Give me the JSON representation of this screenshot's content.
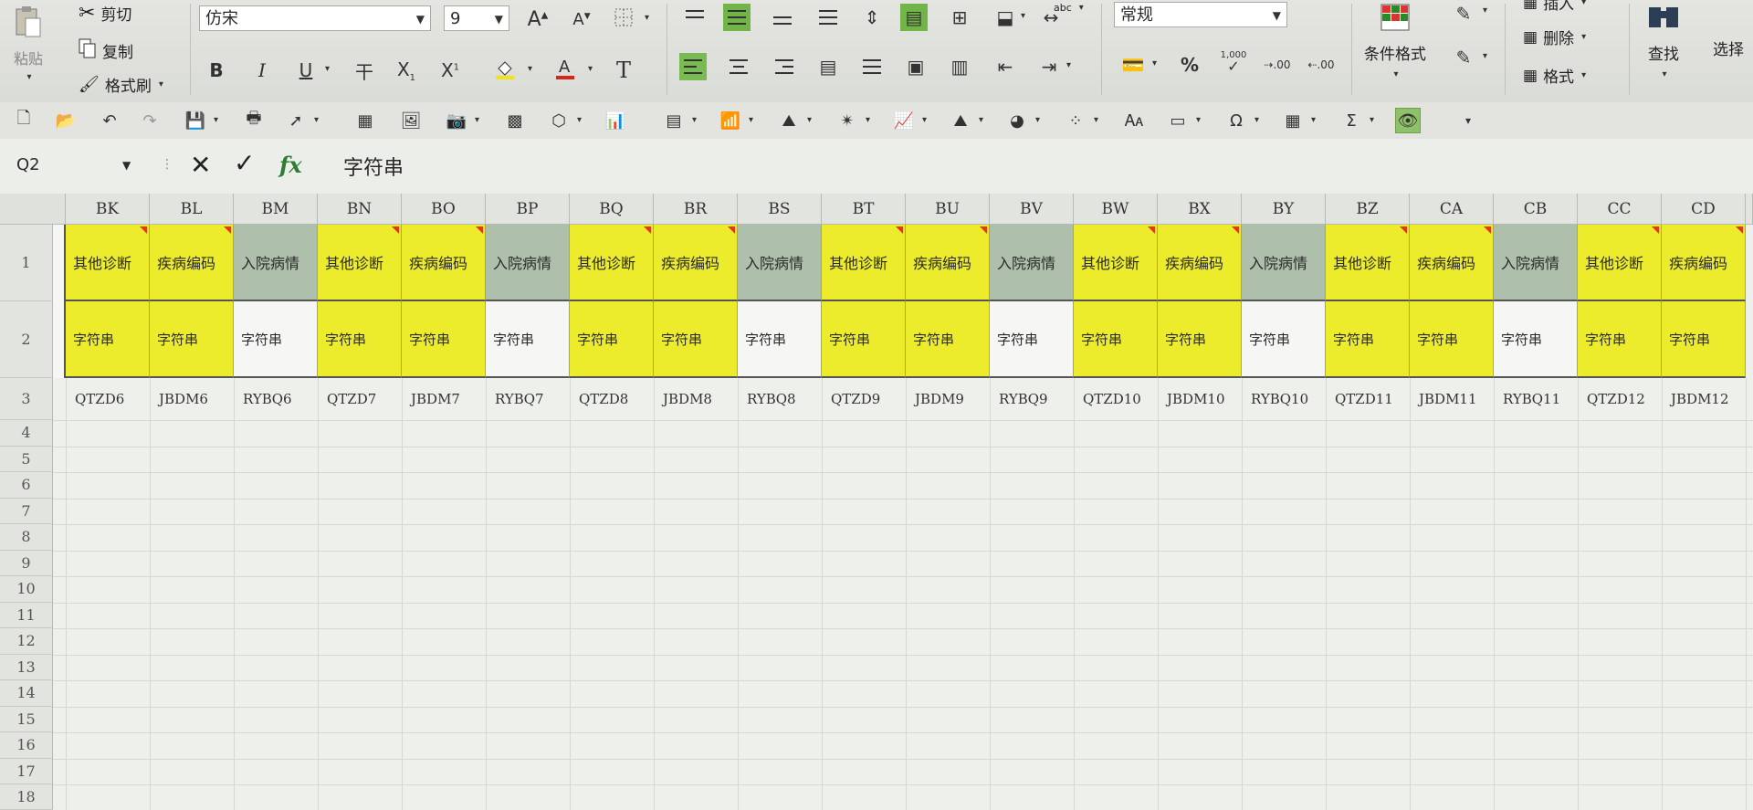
{
  "ribbon": {
    "paste_label": "粘贴",
    "cut_label": "剪切",
    "copy_label": "复制",
    "format_painter_label": "格式刷",
    "font_name": "仿宋",
    "font_size": "9",
    "bold": "B",
    "italic": "I",
    "underline": "U",
    "strike": "干",
    "number_format": "常规",
    "percent": "%",
    "thousands": "1,000",
    "inc_decimal": ".00",
    "dec_decimal": ".00",
    "abc": "abc",
    "conditional_format": "条件格式",
    "insert_label": "插入",
    "delete_label": "删除",
    "format_label": "格式",
    "find_label": "查找",
    "select_label": "选择"
  },
  "formula_bar": {
    "name_box": "Q2",
    "fx": "fx",
    "value": "字符串"
  },
  "sheet": {
    "columns": [
      "BK",
      "BL",
      "BM",
      "BN",
      "BO",
      "BP",
      "BQ",
      "BR",
      "BS",
      "BT",
      "BU",
      "BV",
      "BW",
      "BX",
      "BY",
      "BZ",
      "CA",
      "CB",
      "CC",
      "CD"
    ],
    "rows": [
      "1",
      "2",
      "3",
      "4",
      "5",
      "6",
      "7",
      "8",
      "9",
      "10",
      "11",
      "12",
      "13",
      "14",
      "15",
      "16",
      "17",
      "18"
    ],
    "row1": [
      "其他诊断",
      "疾病编码",
      "入院病情",
      "其他诊断",
      "疾病编码",
      "入院病情",
      "其他诊断",
      "疾病编码",
      "入院病情",
      "其他诊断",
      "疾病编码",
      "入院病情",
      "其他诊断",
      "疾病编码",
      "入院病情",
      "其他诊断",
      "疾病编码",
      "入院病情",
      "其他诊断",
      "疾病编码"
    ],
    "row2": [
      "字符串",
      "字符串",
      "字符串",
      "字符串",
      "字符串",
      "字符串",
      "字符串",
      "字符串",
      "字符串",
      "字符串",
      "字符串",
      "字符串",
      "字符串",
      "字符串",
      "字符串",
      "字符串",
      "字符串",
      "字符串",
      "字符串",
      "字符串"
    ],
    "row3": [
      "QTZD6",
      "JBDM6",
      "RYBQ6",
      "QTZD7",
      "JBDM7",
      "RYBQ7",
      "QTZD8",
      "JBDM8",
      "RYBQ8",
      "QTZD9",
      "JBDM9",
      "RYBQ9",
      "QTZD10",
      "JBDM10",
      "RYBQ10",
      "QTZD11",
      "JBDM11",
      "RYBQ11",
      "QTZD12",
      "JBDM12"
    ]
  },
  "colors": {
    "yellow": "#ecec2c",
    "green_gray": "#aebfab",
    "white": "#f6f6f4",
    "comment_marker": "#e03a1a",
    "accent_green": "#71b448"
  }
}
